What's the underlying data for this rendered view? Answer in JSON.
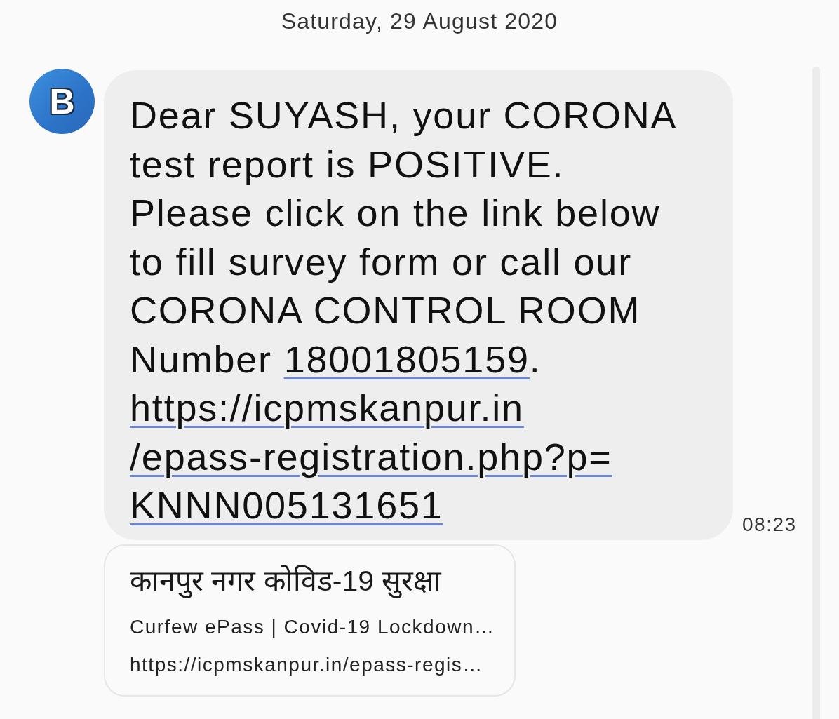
{
  "date_header": "Saturday, 29 August 2020",
  "conversation": {
    "sender": {
      "initial": "B"
    },
    "message": {
      "lines": [
        "Dear SUYASH, your CORONA",
        "test report is POSITIVE.",
        "Please click on the link below",
        "to fill survey form or call our",
        "CORONA CONTROL ROOM",
        "Number"
      ],
      "phone": "18001805159",
      "after_phone": ".",
      "url_lines": [
        "https://icpmskanpur.in",
        "/epass-registration.php?p=",
        "KNNN005131651"
      ],
      "time": "08:23"
    },
    "link_preview": {
      "title": "कानपुर नगर कोविड-19 सुरक्षा",
      "description": "Curfew ePass | Covid-19 Lockdown…",
      "url": "https://icpmskanpur.in/epass-regis…"
    }
  }
}
